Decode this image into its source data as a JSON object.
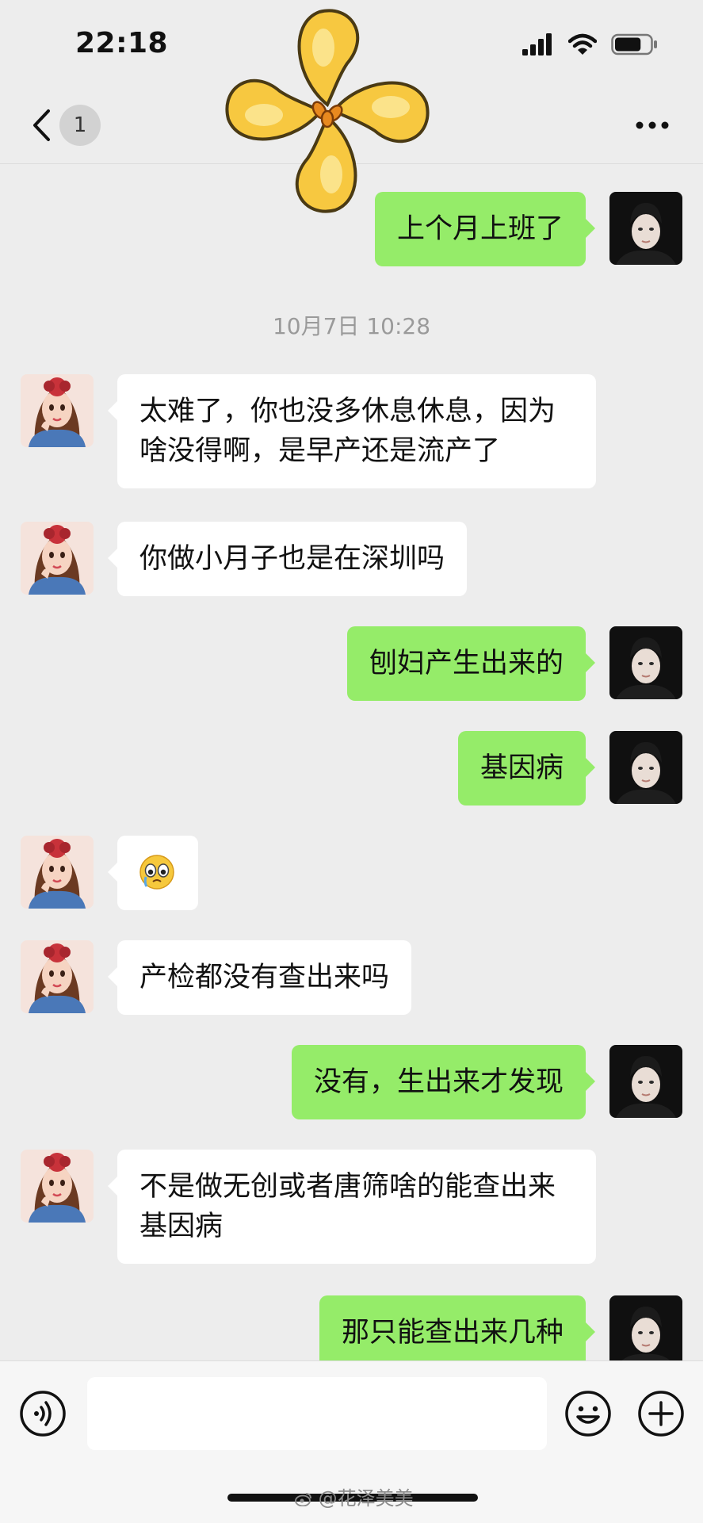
{
  "status_bar": {
    "time": "22:18",
    "battery_level": 0.75
  },
  "nav": {
    "unread_count": "1"
  },
  "chat": {
    "messages": [
      {
        "side": "right",
        "text": "上个月上班了"
      },
      {
        "type": "timestamp",
        "text": "10月7日 10:28"
      },
      {
        "side": "left",
        "text": "太难了，你也没多休息休息，因为啥没得啊，是早产还是流产了"
      },
      {
        "side": "left",
        "text": "你做小月子也是在深圳吗"
      },
      {
        "side": "right",
        "text": "刨妇产生出来的"
      },
      {
        "side": "right",
        "text": "基因病"
      },
      {
        "side": "left",
        "emoji": "crying-face-emoji"
      },
      {
        "side": "left",
        "text": "产检都没有查出来吗"
      },
      {
        "side": "right",
        "text": "没有，生出来才发现"
      },
      {
        "side": "left",
        "text": "不是做无创或者唐筛啥的能查出来基因病"
      },
      {
        "side": "right",
        "text": "那只能查出来几种"
      }
    ]
  },
  "input_bar": {
    "value": "",
    "placeholder": ""
  },
  "watermark": "@花泽美美",
  "colors": {
    "background": "#ededed",
    "sent_bubble": "#95ec69",
    "received_bubble": "#ffffff",
    "timestamp": "#9a9a9a"
  },
  "icons": [
    "back-chevron-icon",
    "more-dots-icon",
    "voice-icon",
    "emoji-icon",
    "plus-icon",
    "signal-icon",
    "wifi-icon",
    "battery-icon",
    "weibo-icon"
  ]
}
